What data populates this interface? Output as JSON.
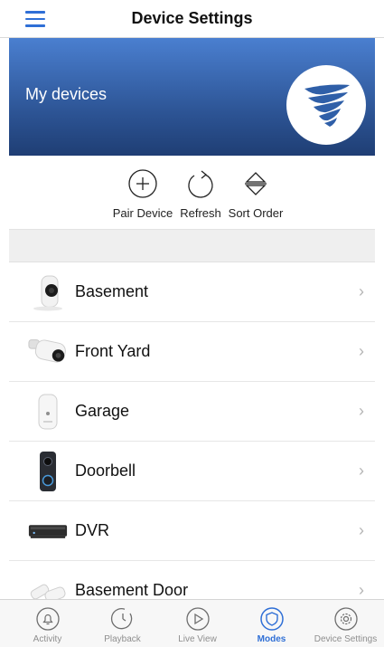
{
  "header": {
    "title": "Device Settings",
    "menu_icon": "hamburger-menu-icon",
    "accent": "#2f6fd6"
  },
  "hero": {
    "title": "My devices",
    "logo_icon": "brand-logo-icon"
  },
  "actions": [
    {
      "label": "Pair Device",
      "icon": "plus-circle-icon"
    },
    {
      "label": "Refresh",
      "icon": "refresh-icon"
    },
    {
      "label": "Sort Order",
      "icon": "sort-order-icon"
    }
  ],
  "devices": [
    {
      "name": "Basement",
      "icon": "indoor-camera-icon"
    },
    {
      "name": "Front Yard",
      "icon": "bullet-camera-icon"
    },
    {
      "name": "Garage",
      "icon": "sensor-icon"
    },
    {
      "name": "Doorbell",
      "icon": "doorbell-icon"
    },
    {
      "name": "DVR",
      "icon": "dvr-icon"
    },
    {
      "name": "Basement Door",
      "icon": "door-sensor-icon"
    }
  ],
  "tabs": [
    {
      "label": "Activity",
      "icon": "bell-icon"
    },
    {
      "label": "Playback",
      "icon": "playback-icon"
    },
    {
      "label": "Live View",
      "icon": "play-icon"
    },
    {
      "label": "Modes",
      "icon": "shield-icon",
      "active": true
    },
    {
      "label": "Device Settings",
      "icon": "gear-icon"
    }
  ]
}
